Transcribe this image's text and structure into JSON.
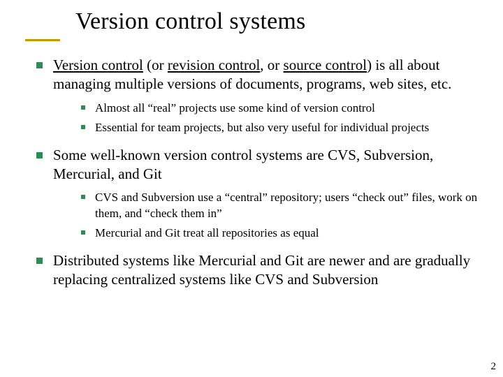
{
  "title": "Version control systems",
  "bullets": {
    "b1": {
      "pre": "Version control",
      "mid1": " (or ",
      "rev": "revision control",
      "mid2": ", or ",
      "src": "source control",
      "post": ") is all about managing multiple versions of documents, programs, web sites, etc.",
      "sub": {
        "s1": "Almost all “real” projects use some kind of version control",
        "s2": "Essential for team projects, but also very useful for individual projects"
      }
    },
    "b2": {
      "text": "Some well-known version control systems are CVS, Subversion, Mercurial, and Git",
      "sub": {
        "s1": "CVS and Subversion use a “central” repository; users “check out” files, work on them, and “check them in”",
        "s2": "Mercurial and Git treat all repositories as equal"
      }
    },
    "b3": {
      "text": "Distributed systems like Mercurial and Git are newer and are gradually replacing centralized systems like CVS and Subversion"
    }
  },
  "page_number": "2"
}
